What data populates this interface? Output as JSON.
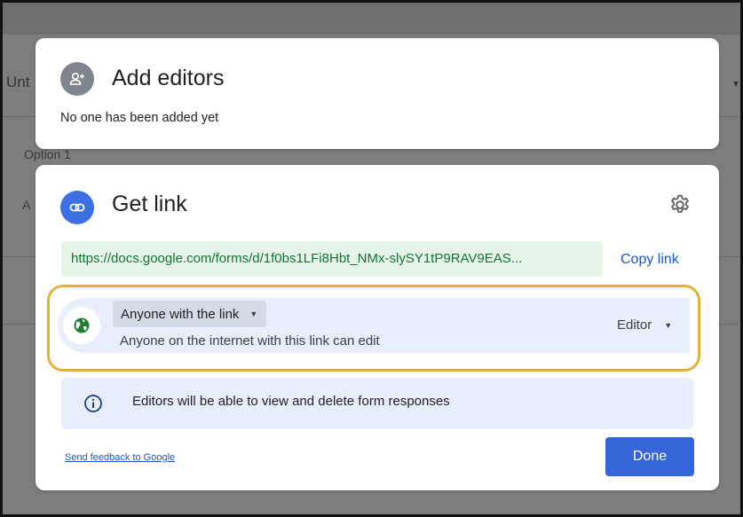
{
  "background": {
    "field_text": "Unt",
    "option_text": "Option 1",
    "letter": "A"
  },
  "add_editors": {
    "title": "Add editors",
    "subtitle": "No one has been added yet"
  },
  "get_link": {
    "title": "Get link",
    "url": "https://docs.google.com/forms/d/1f0bs1LFi8Hbt_NMx-slySY1tP9RAV9EAS...",
    "copy_label": "Copy link",
    "access": {
      "who": "Anyone with the link",
      "description": "Anyone on the internet with this link can edit",
      "role": "Editor"
    },
    "info": "Editors will be able to view and delete form responses",
    "feedback_link": "Send feedback to Google",
    "done_label": "Done"
  },
  "colors": {
    "accent": "#3565d8",
    "url_bg": "#e6f4ea",
    "url_text": "#137333",
    "highlight": "#e2b33a",
    "globe": "#1e7e34"
  },
  "icons": [
    "add-person-icon",
    "link-icon",
    "gear-icon",
    "globe-icon",
    "info-icon",
    "caret-down-icon"
  ]
}
